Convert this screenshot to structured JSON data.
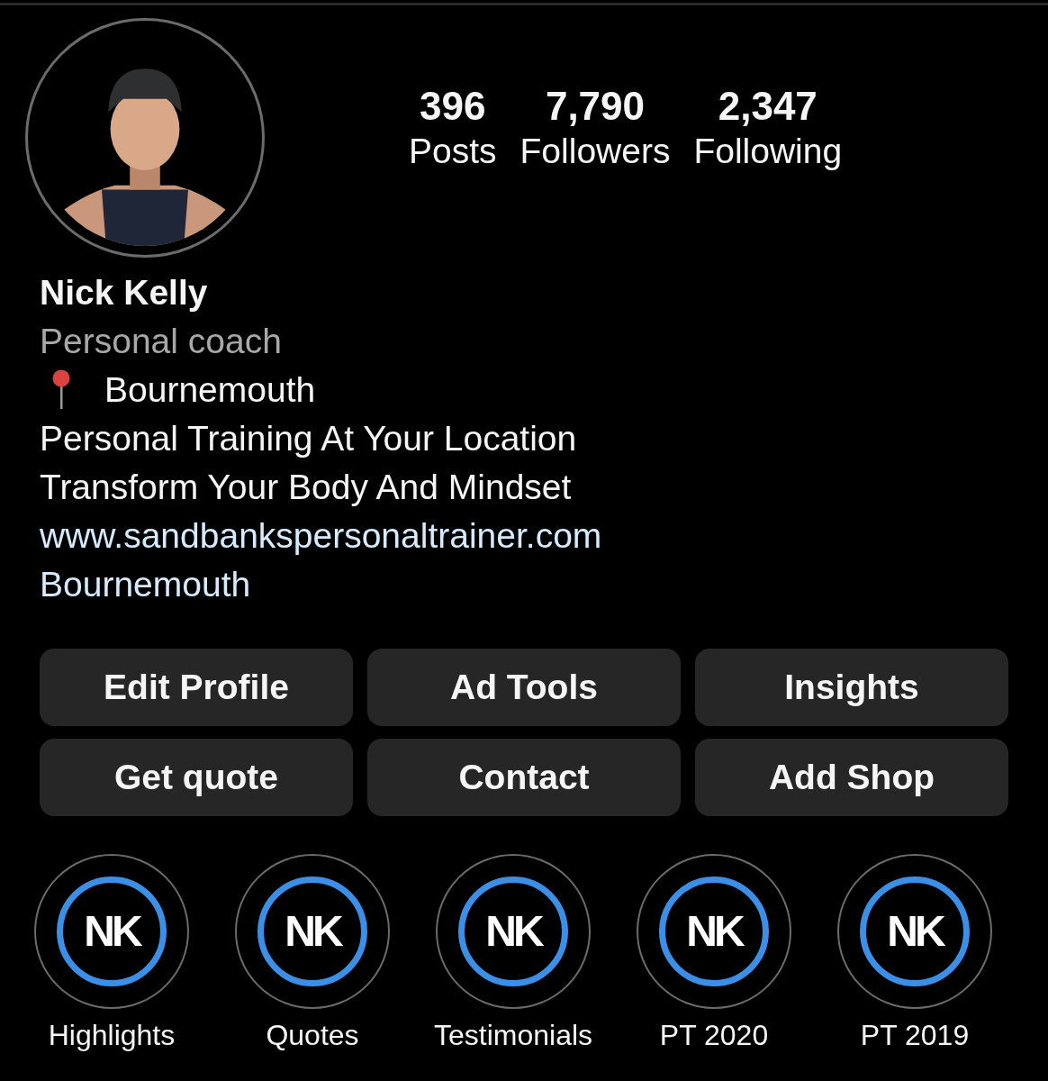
{
  "profile": {
    "stats": [
      {
        "value": "396",
        "label": "Posts"
      },
      {
        "value": "7,790",
        "label": "Followers"
      },
      {
        "value": "2,347",
        "label": "Following"
      }
    ],
    "name": "Nick Kelly",
    "category": "Personal coach",
    "bio": [
      {
        "kind": "location",
        "text": "Bournemouth"
      },
      {
        "kind": "text",
        "text": "Personal Training At Your Location"
      },
      {
        "kind": "text",
        "text": "Transform Your Body And Mindset"
      },
      {
        "kind": "link",
        "text": "www.sandbankspersonaltrainer.com"
      },
      {
        "kind": "link",
        "text": "Bournemouth"
      }
    ]
  },
  "buttons": [
    "Edit Profile",
    "Ad Tools",
    "Insights",
    "Get quote",
    "Contact",
    "Add Shop"
  ],
  "highlights": [
    {
      "logo": "NK",
      "label": "Highlights"
    },
    {
      "logo": "NK",
      "label": "Quotes"
    },
    {
      "logo": "NK",
      "label": "Testimonials"
    },
    {
      "logo": "NK",
      "label": "PT 2020"
    },
    {
      "logo": "NK",
      "label": "PT 2019"
    }
  ]
}
